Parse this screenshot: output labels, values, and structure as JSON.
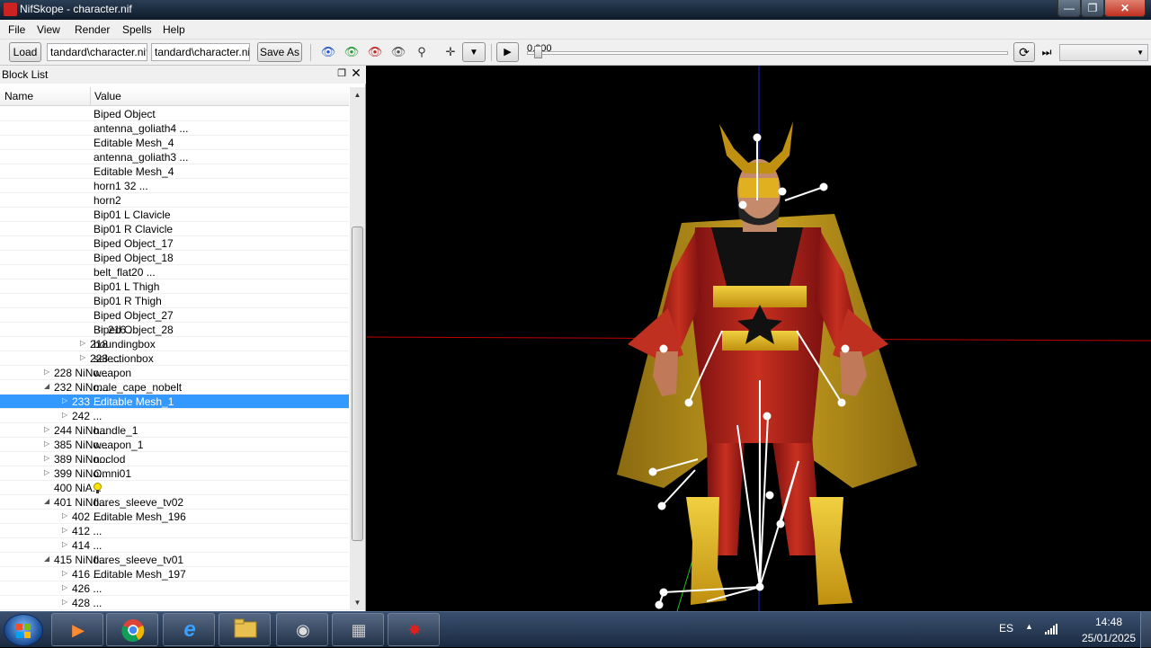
{
  "window": {
    "title": "NifSkope - character.nif",
    "min": "—",
    "max": "❐",
    "close": "✕"
  },
  "menu": [
    "File",
    "View",
    "Render",
    "Spells",
    "Help"
  ],
  "toolbar": {
    "load_label": "Load",
    "load_path": "tandard\\character.nif",
    "save_path": "tandard\\character.nif",
    "save_as_label": "Save As",
    "time_value": "0.000",
    "dropdown_value": ""
  },
  "block_list": {
    "title": "Block List",
    "col_name": "Name",
    "col_value": "Value",
    "rows": [
      {
        "indent": 0,
        "arrow": "",
        "name": "",
        "value": "Biped Object"
      },
      {
        "indent": 0,
        "arrow": "",
        "name": "",
        "value": "antenna_goliath4 ..."
      },
      {
        "indent": 0,
        "arrow": "",
        "name": "",
        "value": "Editable Mesh_4"
      },
      {
        "indent": 0,
        "arrow": "",
        "name": "",
        "value": "antenna_goliath3 ..."
      },
      {
        "indent": 0,
        "arrow": "",
        "name": "",
        "value": "Editable Mesh_4"
      },
      {
        "indent": 0,
        "arrow": "",
        "name": "",
        "value": "horn1          32 ..."
      },
      {
        "indent": 0,
        "arrow": "",
        "name": "",
        "value": "horn2"
      },
      {
        "indent": 0,
        "arrow": "",
        "name": "",
        "value": "Bip01 L Clavicle"
      },
      {
        "indent": 0,
        "arrow": "",
        "name": "",
        "value": "Bip01 R Clavicle"
      },
      {
        "indent": 0,
        "arrow": "",
        "name": "",
        "value": "Biped Object_17"
      },
      {
        "indent": 0,
        "arrow": "",
        "name": "",
        "value": "Biped Object_18"
      },
      {
        "indent": 0,
        "arrow": "",
        "name": "",
        "value": "belt_flat20 ..."
      },
      {
        "indent": 0,
        "arrow": "",
        "name": "",
        "value": "Bip01 L Thigh"
      },
      {
        "indent": 0,
        "arrow": "",
        "name": "",
        "value": "Bip01 R Thigh"
      },
      {
        "indent": 0,
        "arrow": "",
        "name": "",
        "value": "Biped Object_27"
      },
      {
        "indent": 4,
        "arrow": "▷",
        "name": "216 ...",
        "value": "Biped Object_28"
      },
      {
        "indent": 3,
        "arrow": "▷",
        "name": "218",
        "value": "boundingbox"
      },
      {
        "indent": 3,
        "arrow": "▷",
        "name": "223 ...",
        "value": "selectionbox"
      },
      {
        "indent": 1,
        "arrow": "▷",
        "name": "228 NiNo...",
        "value": "weapon"
      },
      {
        "indent": 1,
        "arrow": "◢",
        "name": "232 NiNo...",
        "value": "male_cape_nobelt"
      },
      {
        "indent": 2,
        "arrow": "▷",
        "name": "233 ...",
        "value": "Editable Mesh_1",
        "selected": true
      },
      {
        "indent": 2,
        "arrow": "▷",
        "name": "242 ...",
        "value": ""
      },
      {
        "indent": 1,
        "arrow": "▷",
        "name": "244 NiNo...",
        "value": "handle_1"
      },
      {
        "indent": 1,
        "arrow": "▷",
        "name": "385 NiNo...",
        "value": "weapon_1"
      },
      {
        "indent": 1,
        "arrow": "▷",
        "name": "389 NiNo...",
        "value": "noclod"
      },
      {
        "indent": 1,
        "arrow": "▷",
        "name": "399 NiNo...",
        "value": "Omni01"
      },
      {
        "indent": 1,
        "arrow": "",
        "name": "400 NiA...",
        "value": "",
        "bulb": true
      },
      {
        "indent": 1,
        "arrow": "◢",
        "name": "401 NiNo...",
        "value": "flares_sleeve_tv02"
      },
      {
        "indent": 2,
        "arrow": "▷",
        "name": "402 ...",
        "value": "Editable Mesh_196"
      },
      {
        "indent": 2,
        "arrow": "▷",
        "name": "412 ...",
        "value": ""
      },
      {
        "indent": 2,
        "arrow": "▷",
        "name": "414 ...",
        "value": ""
      },
      {
        "indent": 1,
        "arrow": "◢",
        "name": "415 NiNo...",
        "value": "flares_sleeve_tv01"
      },
      {
        "indent": 2,
        "arrow": "▷",
        "name": "416 ...",
        "value": "Editable Mesh_197"
      },
      {
        "indent": 2,
        "arrow": "▷",
        "name": "426 ...",
        "value": ""
      },
      {
        "indent": 2,
        "arrow": "▷",
        "name": "428 ...",
        "value": ""
      }
    ]
  },
  "taskbar": {
    "apps": [
      "media-player-icon",
      "chrome-icon",
      "ie-icon",
      "explorer-icon",
      "audio-icon",
      "video-icon",
      "nifskope-icon"
    ],
    "lang": "ES",
    "time": "14:48",
    "date": "25/01/2025"
  }
}
